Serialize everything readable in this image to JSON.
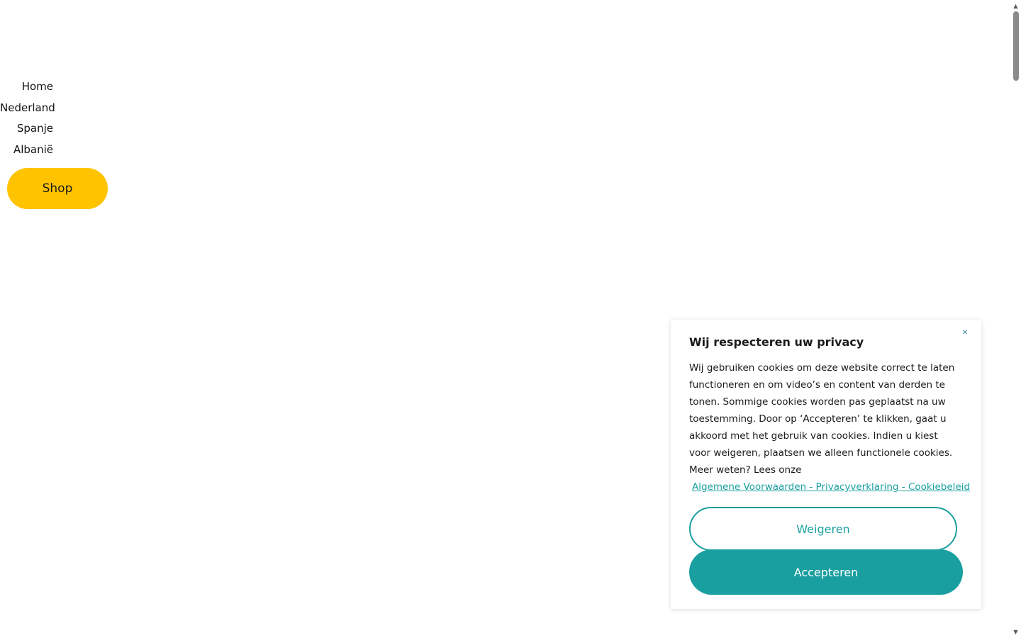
{
  "nav": {
    "items": [
      {
        "label": "Home"
      },
      {
        "label": "Nederland"
      },
      {
        "label": "Spanje"
      },
      {
        "label": "Albanië"
      }
    ],
    "shop_label": "Shop"
  },
  "cookie": {
    "title": "Wij respecteren uw privacy",
    "close_glyph": "×",
    "body": "Wij gebruiken cookies om deze website correct te laten functioneren en om video’s en content van derden te tonen. Sommige cookies worden pas geplaatst na uw toestemming. Door op ‘Accepteren’ te klikken, gaat u akkoord met het gebruik van cookies. Indien u kiest voor weigeren, plaatsen we alleen functionele cookies. Meer weten? Lees onze",
    "links_text": "Algemene Voorwaarden - Privacyverklaring - Cookiebeleid",
    "decline_label": "Weigeren",
    "accept_label": "Accepteren"
  },
  "colors": {
    "shop_yellow": "#ffc300",
    "teal": "#1a9fa0"
  },
  "icons": {
    "close": "close-icon",
    "scroll_up": "scroll-up-arrow-icon",
    "scroll_down": "scroll-down-arrow-icon"
  }
}
